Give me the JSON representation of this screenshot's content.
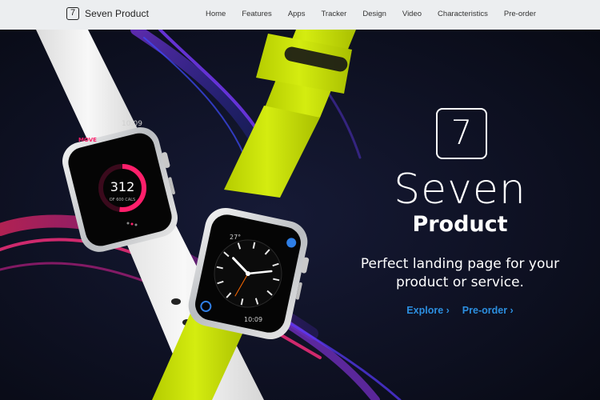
{
  "brand": {
    "logo_digit": "7",
    "name": "Seven Product"
  },
  "nav": {
    "items": [
      {
        "label": "Home"
      },
      {
        "label": "Features"
      },
      {
        "label": "Apps"
      },
      {
        "label": "Tracker"
      },
      {
        "label": "Design"
      },
      {
        "label": "Video"
      },
      {
        "label": "Characteristics"
      },
      {
        "label": "Pre-order"
      }
    ]
  },
  "hero": {
    "logo_digit": "7",
    "title": "Seven",
    "subtitle": "Product",
    "tagline_line1": "Perfect landing page for your",
    "tagline_line2": "product or service.",
    "cta_explore": "Explore ›",
    "cta_preorder": "Pre-order ›"
  },
  "watch_white": {
    "time": "10:09",
    "app_label": "MOVE",
    "value": "312",
    "value_caption": "OF 600 CALS",
    "progress": 0.52
  },
  "watch_green": {
    "temp": "27°",
    "time": "10:09"
  },
  "colors": {
    "accent_blue": "#2c8fe0",
    "band_green": "#c8e000",
    "band_white": "#f2f2f2",
    "activity_ring": "#ff1f6b",
    "background": "#0a0d1a"
  }
}
